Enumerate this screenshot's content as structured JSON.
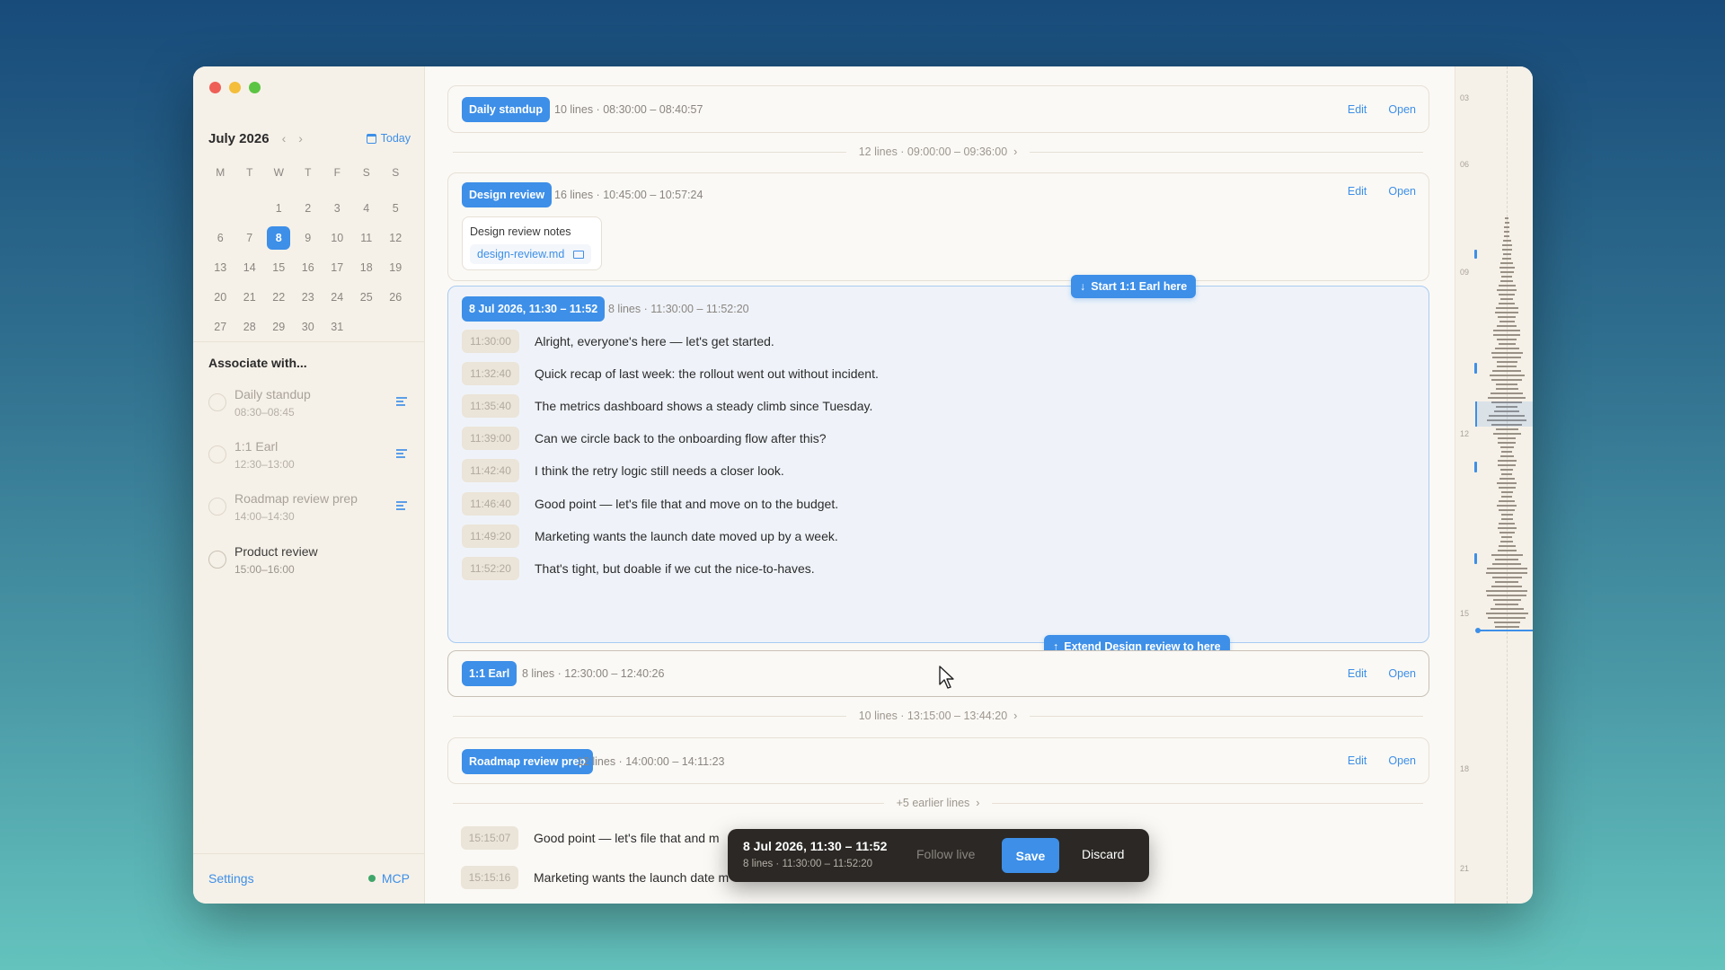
{
  "calendar": {
    "month_label": "July 2026",
    "prev_icon": "‹",
    "next_icon": "›",
    "today_label": "Today",
    "weekdays": [
      "M",
      "T",
      "W",
      "T",
      "F",
      "S",
      "S"
    ],
    "days": [
      "1",
      "2",
      "3",
      "4",
      "5",
      "6",
      "7",
      "8",
      "9",
      "10",
      "11",
      "12",
      "13",
      "14",
      "15",
      "16",
      "17",
      "18",
      "19",
      "20",
      "21",
      "22",
      "23",
      "24",
      "25",
      "26",
      "27",
      "28",
      "29",
      "30",
      "31"
    ],
    "selected_day": "8"
  },
  "associate": {
    "title": "Associate with...",
    "items": [
      {
        "name": "Daily standup",
        "time": "08:30–08:45"
      },
      {
        "name": "1:1 Earl",
        "time": "12:30–13:00"
      },
      {
        "name": "Roadmap review prep",
        "time": "14:00–14:30"
      },
      {
        "name": "Product review",
        "time": "15:00–16:00"
      }
    ]
  },
  "footer": {
    "settings_label": "Settings",
    "mcp_label": "MCP"
  },
  "meetings": {
    "standup": {
      "tag": "Daily standup",
      "meta": "10 lines · 08:30:00 – 08:40:57"
    },
    "gap1": "12 lines · 09:00:00 – 09:36:00",
    "design": {
      "tag": "Design review",
      "meta": "16 lines · 10:45:00 – 10:57:24",
      "notes_title": "Design review notes",
      "notes_file": "design-review.md"
    },
    "earl": {
      "tag": "1:1 Earl",
      "meta": "8 lines · 12:30:00 – 12:40:26"
    },
    "gap2": "10 lines · 13:15:00 – 13:44:20",
    "roadmap": {
      "tag": "Roadmap review prep",
      "meta": "12 lines · 14:00:00 – 14:11:23"
    },
    "earlier": "+5 earlier lines"
  },
  "actions": {
    "edit": "Edit",
    "open": "Open",
    "gap_chevron": "›"
  },
  "selection": {
    "tag": "8 Jul 2026, 11:30 – 11:52",
    "meta": "8 lines · 11:30:00 – 11:52:20",
    "start_btn": "Start 1:1 Earl here",
    "extend_btn": "Extend Design review to here",
    "lines": [
      {
        "t": "11:30:00",
        "text": "Alright, everyone's here — let's get started."
      },
      {
        "t": "11:32:40",
        "text": "Quick recap of last week: the rollout went out without incident."
      },
      {
        "t": "11:35:40",
        "text": "The metrics dashboard shows a steady climb since Tuesday."
      },
      {
        "t": "11:39:00",
        "text": "Can we circle back to the onboarding flow after this?"
      },
      {
        "t": "11:42:40",
        "text": "I think the retry logic still needs a closer look."
      },
      {
        "t": "11:46:40",
        "text": "Good point — let's file that and move on to the budget."
      },
      {
        "t": "11:49:20",
        "text": "Marketing wants the launch date moved up by a week."
      },
      {
        "t": "11:52:20",
        "text": "That's tight, but doable if we cut the nice-to-haves."
      }
    ]
  },
  "product_lines": [
    {
      "t": "15:15:07",
      "text": "Good point — let's file that and m"
    },
    {
      "t": "15:15:16",
      "text": "Marketing wants the launch date m"
    }
  ],
  "toolbar": {
    "title": "8 Jul 2026, 11:30 – 11:52",
    "sub": "8 lines · 11:30:00 – 11:52:20",
    "follow": "Follow live",
    "save": "Save",
    "discard": "Discard"
  },
  "minimap": {
    "hours": [
      "03",
      "06",
      "09",
      "12",
      "15",
      "18",
      "21"
    ]
  },
  "colors": {
    "accent": "#3d8fe8",
    "sidebar_bg": "#f6f1e8",
    "selection_bg": "#eff3f9",
    "toolbar_bg": "#2b2825"
  }
}
